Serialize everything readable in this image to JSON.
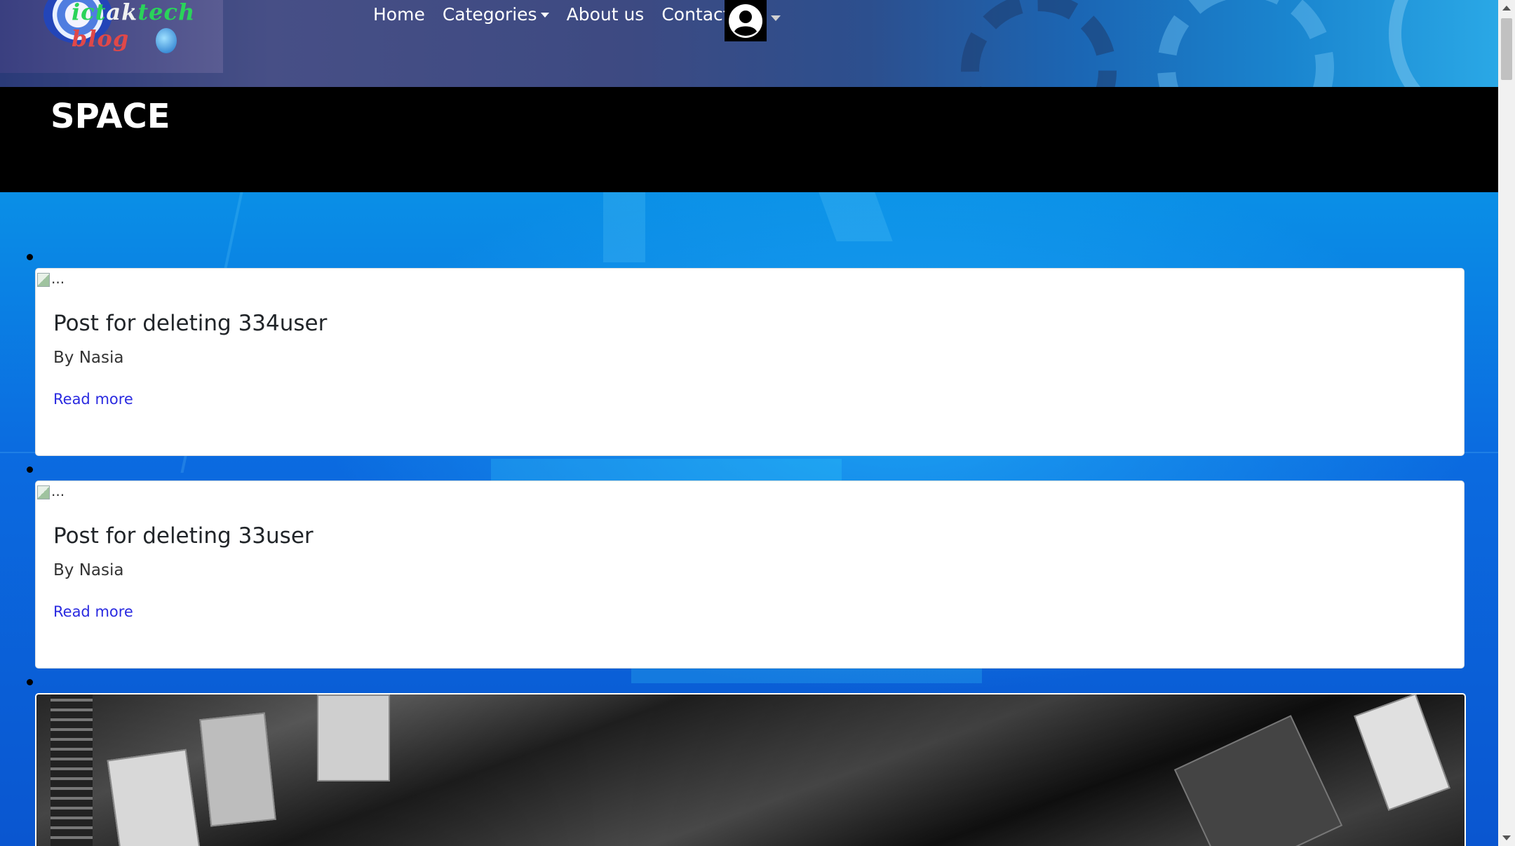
{
  "header": {
    "logo": {
      "text_a": "ict",
      "text_b": "ak",
      "text_c": "tech ",
      "text_d": "b",
      "text_e": "log"
    },
    "nav": {
      "home": "Home",
      "categories": "Categories",
      "about": "About us",
      "contact": "Contact us"
    }
  },
  "banner": {
    "title": "SPACE"
  },
  "posts": [
    {
      "img_alt": "...",
      "title": "Post for deleting 334user",
      "author": "By Nasia",
      "link": "Read more"
    },
    {
      "img_alt": "...",
      "title": "Post for deleting 33user",
      "author": "By Nasia",
      "link": "Read more"
    }
  ],
  "colors": {
    "banner_bg": "#000000",
    "link": "#2a2ae0",
    "content_bg": "#0a6fe0"
  }
}
